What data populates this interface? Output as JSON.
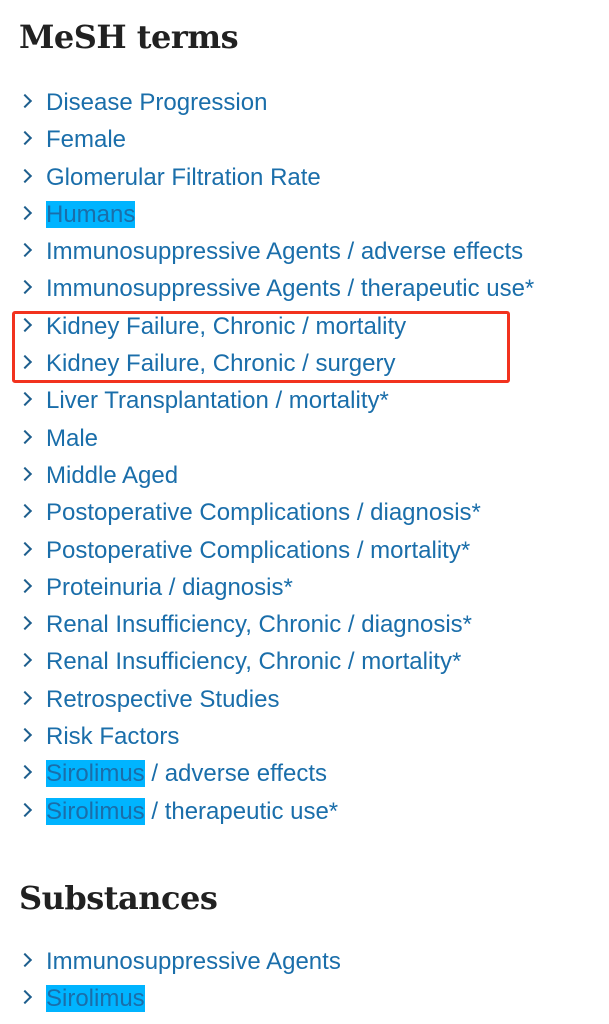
{
  "mesh_section": {
    "title": "MeSH terms",
    "items": [
      {
        "highlight": "",
        "label": "Disease Progression"
      },
      {
        "highlight": "",
        "label": "Female"
      },
      {
        "highlight": "",
        "label": "Glomerular Filtration Rate"
      },
      {
        "highlight": "Humans",
        "label": ""
      },
      {
        "highlight": "",
        "label": "Immunosuppressive Agents / adverse effects"
      },
      {
        "highlight": "",
        "label": "Immunosuppressive Agents / therapeutic use*"
      },
      {
        "highlight": "",
        "label": "Kidney Failure, Chronic / mortality"
      },
      {
        "highlight": "",
        "label": "Kidney Failure, Chronic / surgery"
      },
      {
        "highlight": "",
        "label": "Liver Transplantation / mortality*"
      },
      {
        "highlight": "",
        "label": "Male"
      },
      {
        "highlight": "",
        "label": "Middle Aged"
      },
      {
        "highlight": "",
        "label": "Postoperative Complications / diagnosis*"
      },
      {
        "highlight": "",
        "label": "Postoperative Complications / mortality*"
      },
      {
        "highlight": "",
        "label": "Proteinuria / diagnosis*"
      },
      {
        "highlight": "",
        "label": "Renal Insufficiency, Chronic / diagnosis*"
      },
      {
        "highlight": "",
        "label": "Renal Insufficiency, Chronic / mortality*"
      },
      {
        "highlight": "",
        "label": "Retrospective Studies"
      },
      {
        "highlight": "",
        "label": "Risk Factors"
      },
      {
        "highlight": "Sirolimus",
        "label": " / adverse effects"
      },
      {
        "highlight": "Sirolimus",
        "label": " / therapeutic use*"
      }
    ]
  },
  "substances_section": {
    "title": "Substances",
    "items": [
      {
        "highlight": "",
        "label": "Immunosuppressive Agents"
      },
      {
        "highlight": "Sirolimus",
        "label": ""
      }
    ]
  },
  "annotation": {
    "boxed_items": [
      "Kidney Failure, Chronic / mortality",
      "Kidney Failure, Chronic / surgery"
    ],
    "box_color": "#f2321e"
  },
  "colors": {
    "link": "#1a6eaa",
    "highlight": "#00b4ff",
    "heading": "#212121"
  }
}
